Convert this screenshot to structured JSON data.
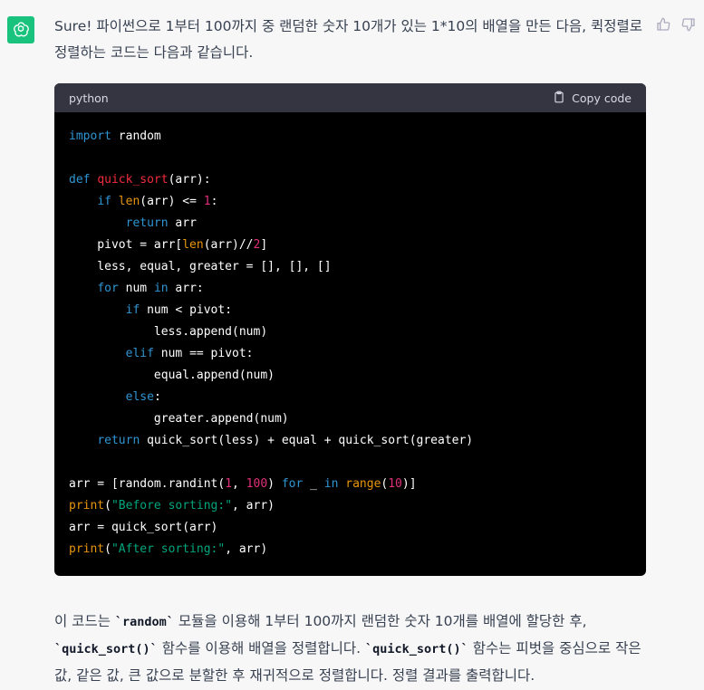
{
  "message": {
    "intro_text": "Sure! 파이썬으로 1부터 100까지 중 랜덤한 숫자 10개가 있는 1*10의 배열을 만든 다음, 퀵정렬로 정렬하는 코드는 다음과 같습니다."
  },
  "code_block": {
    "language": "python",
    "copy_label": "Copy code",
    "lines": [
      [
        {
          "t": "import",
          "c": "kw"
        },
        {
          "t": " random",
          "c": ""
        }
      ],
      [],
      [
        {
          "t": "def",
          "c": "kw"
        },
        {
          "t": " ",
          "c": ""
        },
        {
          "t": "quick_sort",
          "c": "fn"
        },
        {
          "t": "(arr):",
          "c": ""
        }
      ],
      [
        {
          "t": "    ",
          "c": ""
        },
        {
          "t": "if",
          "c": "kw"
        },
        {
          "t": " ",
          "c": ""
        },
        {
          "t": "len",
          "c": "bi"
        },
        {
          "t": "(arr) <= ",
          "c": ""
        },
        {
          "t": "1",
          "c": "num"
        },
        {
          "t": ":",
          "c": ""
        }
      ],
      [
        {
          "t": "        ",
          "c": ""
        },
        {
          "t": "return",
          "c": "kw"
        },
        {
          "t": " arr",
          "c": ""
        }
      ],
      [
        {
          "t": "    pivot = arr[",
          "c": ""
        },
        {
          "t": "len",
          "c": "bi"
        },
        {
          "t": "(arr)//",
          "c": ""
        },
        {
          "t": "2",
          "c": "num"
        },
        {
          "t": "]",
          "c": ""
        }
      ],
      [
        {
          "t": "    less, equal, greater = [], [], []",
          "c": ""
        }
      ],
      [
        {
          "t": "    ",
          "c": ""
        },
        {
          "t": "for",
          "c": "kw"
        },
        {
          "t": " num ",
          "c": ""
        },
        {
          "t": "in",
          "c": "kw"
        },
        {
          "t": " arr:",
          "c": ""
        }
      ],
      [
        {
          "t": "        ",
          "c": ""
        },
        {
          "t": "if",
          "c": "kw"
        },
        {
          "t": " num < pivot:",
          "c": ""
        }
      ],
      [
        {
          "t": "            less.append(num)",
          "c": ""
        }
      ],
      [
        {
          "t": "        ",
          "c": ""
        },
        {
          "t": "elif",
          "c": "kw"
        },
        {
          "t": " num == pivot:",
          "c": ""
        }
      ],
      [
        {
          "t": "            equal.append(num)",
          "c": ""
        }
      ],
      [
        {
          "t": "        ",
          "c": ""
        },
        {
          "t": "else",
          "c": "kw"
        },
        {
          "t": ":",
          "c": ""
        }
      ],
      [
        {
          "t": "            greater.append(num)",
          "c": ""
        }
      ],
      [
        {
          "t": "    ",
          "c": ""
        },
        {
          "t": "return",
          "c": "kw"
        },
        {
          "t": " quick_sort(less) + equal + quick_sort(greater)",
          "c": ""
        }
      ],
      [],
      [
        {
          "t": "arr = [random.randint(",
          "c": ""
        },
        {
          "t": "1",
          "c": "num"
        },
        {
          "t": ", ",
          "c": ""
        },
        {
          "t": "100",
          "c": "num"
        },
        {
          "t": ") ",
          "c": ""
        },
        {
          "t": "for",
          "c": "kw"
        },
        {
          "t": " _ ",
          "c": ""
        },
        {
          "t": "in",
          "c": "kw"
        },
        {
          "t": " ",
          "c": ""
        },
        {
          "t": "range",
          "c": "bi"
        },
        {
          "t": "(",
          "c": ""
        },
        {
          "t": "10",
          "c": "num"
        },
        {
          "t": ")]",
          "c": ""
        }
      ],
      [
        {
          "t": "print",
          "c": "bi"
        },
        {
          "t": "(",
          "c": ""
        },
        {
          "t": "\"Before sorting:\"",
          "c": "str"
        },
        {
          "t": ", arr)",
          "c": ""
        }
      ],
      [
        {
          "t": "arr = quick_sort(arr)",
          "c": ""
        }
      ],
      [
        {
          "t": "print",
          "c": "bi"
        },
        {
          "t": "(",
          "c": ""
        },
        {
          "t": "\"After sorting:\"",
          "c": "str"
        },
        {
          "t": ", arr)",
          "c": ""
        }
      ]
    ]
  },
  "outro": {
    "segments": [
      {
        "t": "이 코드는 ",
        "code": false
      },
      {
        "t": "`random`",
        "code": true
      },
      {
        "t": " 모듈을 이용해 1부터 100까지 랜덤한 숫자 10개를 배열에 할당한 후, ",
        "code": false
      },
      {
        "t": "`quick_sort()`",
        "code": true
      },
      {
        "t": " 함수를 이용해 배열을 정렬합니다. ",
        "code": false
      },
      {
        "t": "`quick_sort()`",
        "code": true
      },
      {
        "t": " 함수는 피벗을 중심으로 작은 값, 같은 값, 큰 값으로 분할한 후 재귀적으로 정렬합니다. 정렬 결과를 출력합니다.",
        "code": false
      }
    ]
  },
  "icons": {
    "avatar": "openai-logo-icon",
    "thumbs_up": "thumbs-up-icon",
    "thumbs_down": "thumbs-down-icon",
    "copy": "clipboard-icon"
  },
  "colors": {
    "avatar_bg": "#19c37d",
    "code_bg": "#000000",
    "code_header_bg": "#343541",
    "keyword": "#2e95d3",
    "function_name": "#f22c3d",
    "number": "#df3079",
    "string": "#00a67d",
    "builtin": "#e9950c"
  }
}
